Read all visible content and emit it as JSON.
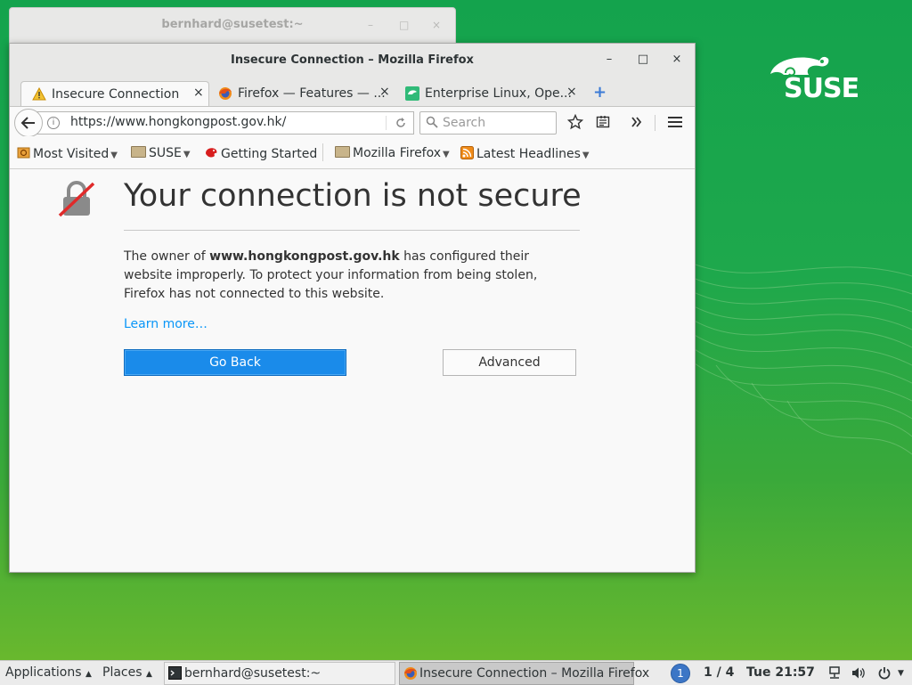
{
  "desktop": {
    "brand": "SUSE"
  },
  "background_window": {
    "title": "bernhard@susetest:~",
    "minimize": "–",
    "maximize": "□",
    "close": "×"
  },
  "window": {
    "title": "Insecure Connection – Mozilla Firefox",
    "minimize": "–",
    "maximize": "□",
    "close": "×"
  },
  "tabs": [
    {
      "label": "Insecure Connection",
      "icon": "warning-icon",
      "close": "×"
    },
    {
      "label": "Firefox — Features — ...",
      "icon": "firefox-icon",
      "close": "×"
    },
    {
      "label": "Enterprise Linux, Ope...",
      "icon": "suse-chameleon-icon",
      "close": "×"
    }
  ],
  "new_tab": "+",
  "navbar": {
    "url": "https://www.hongkongpost.gov.hk/",
    "search_placeholder": "Search"
  },
  "bookmarks": [
    {
      "label": "Most Visited",
      "icon": "most-visited-icon",
      "dropdown": true
    },
    {
      "label": "SUSE",
      "icon": "folder-icon",
      "dropdown": true
    },
    {
      "label": "Getting Started",
      "icon": "getting-started-icon",
      "dropdown": false
    },
    {
      "label": "Mozilla Firefox",
      "icon": "folder-icon",
      "dropdown": true
    },
    {
      "label": "Latest Headlines",
      "icon": "rss-icon",
      "dropdown": true
    }
  ],
  "page": {
    "heading": "Your connection is not secure",
    "para_prefix": "The owner of ",
    "para_domain": "www.hongkongpost.gov.hk",
    "para_suffix": " has configured their website improperly. To protect your information from being stolen, Firefox has not connected to this website.",
    "learn_more": "Learn more…",
    "go_back": "Go Back",
    "advanced": "Advanced"
  },
  "taskbar": {
    "applications": "Applications",
    "places": "Places",
    "tasks": [
      {
        "label": "bernhard@susetest:~",
        "active": false
      },
      {
        "label": "Insecure Connection – Mozilla Firefox",
        "active": true
      }
    ],
    "workspace_number": "1",
    "workspace_label": "1 / 4",
    "clock": "Tue 21:57"
  },
  "colors": {
    "desktop_green": "#1ea84c",
    "primary_button": "#1a8bea",
    "link": "#0996f8"
  }
}
